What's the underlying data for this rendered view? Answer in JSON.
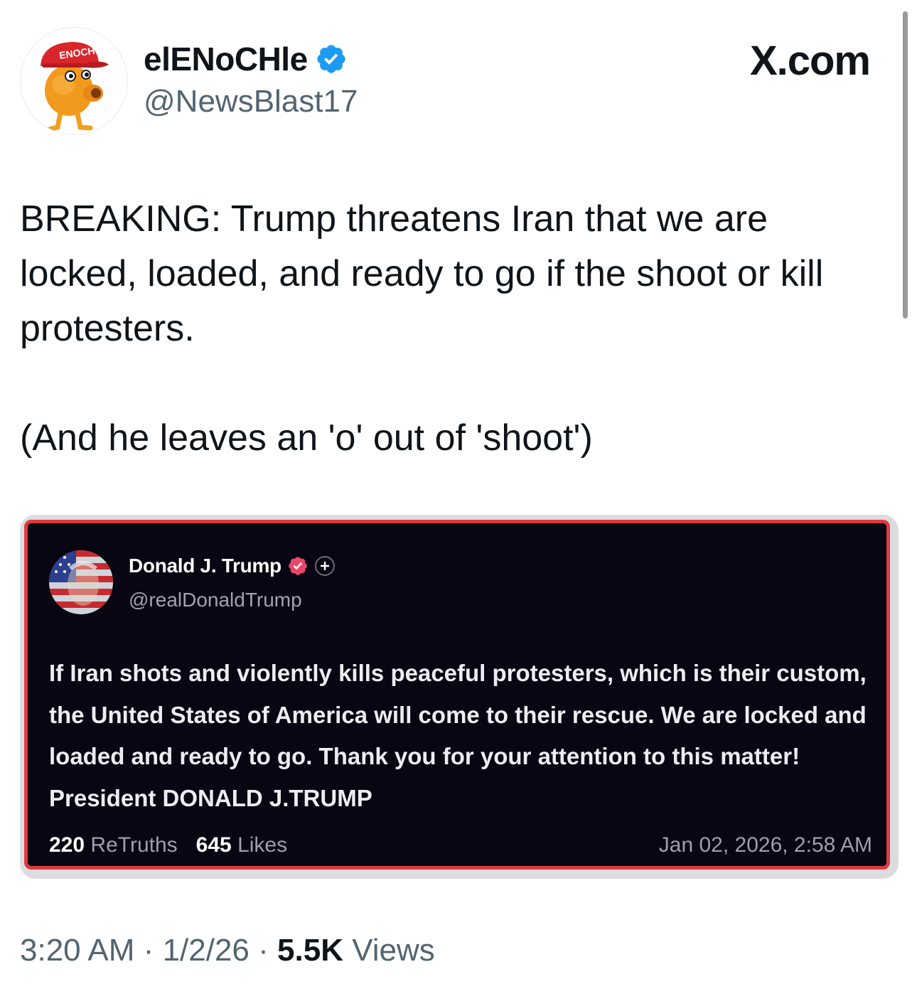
{
  "author": {
    "display_name": "elENoCHle",
    "handle": "@NewsBlast17",
    "verified": true,
    "avatar_hat_text": "ENOCH"
  },
  "brand": "X.com",
  "tweet": {
    "text": "BREAKING: Trump threatens Iran that we are locked, loaded, and ready to go if the shoot or kill protesters.\n\n(And he leaves an 'o' out of 'shoot')"
  },
  "quoted_post": {
    "display_name": "Donald J. Trump",
    "handle": "@realDonaldTrump",
    "text": "If Iran shots and violently kills peaceful protesters, which is their custom, the United States of America will come to their rescue. We are locked and loaded and ready to go. Thank you for your attention to this matter! President DONALD J.TRUMP",
    "retruths_count": "220",
    "retruths_label": "ReTruths",
    "likes_count": "645",
    "likes_label": "Likes",
    "date": "Jan 02, 2026, 2:58 AM",
    "border_color": "#e03a3e",
    "background_color": "#070612"
  },
  "meta": {
    "time": "3:20 AM",
    "separator": "·",
    "date": "1/2/26",
    "views_count": "5.5K",
    "views_label": "Views"
  },
  "colors": {
    "text_primary": "#0f1419",
    "text_secondary": "#536471",
    "verified_blue": "#1d9bf0",
    "truth_badge_pink": "#e8476a"
  }
}
